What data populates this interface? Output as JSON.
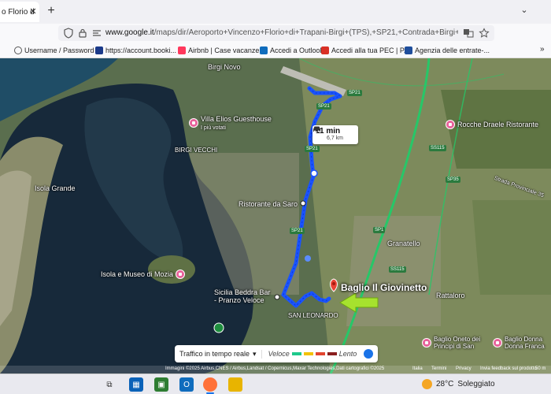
{
  "browser": {
    "tab_title": "o Florio d",
    "tab_close": "✕",
    "new_tab": "+",
    "tab_menu": "⌄",
    "url_host": "www.google.it",
    "url_path": "/maps/dir/Aeroporto+Vincenzo+Florio+di+Trapani-Birgi+(TPS),+SP21,+Contrada+Birgi+Nivaloro,",
    "bookmarks": [
      {
        "label": "Username / Password ...",
        "icon": "globe-icon",
        "color": "#555555"
      },
      {
        "label": "https://account.booki...",
        "icon": "booking-icon",
        "color": "#1b3a8a"
      },
      {
        "label": "Airbnb | Case vacanze,...",
        "icon": "airbnb-icon",
        "color": "#ff385c"
      },
      {
        "label": "Accedi a Outlook",
        "icon": "outlook-icon",
        "color": "#0f6cbd"
      },
      {
        "label": "Accedi alla tua PEC | P...",
        "icon": "pec-icon",
        "color": "#d93025"
      },
      {
        "label": "Agenzia delle entrate-...",
        "icon": "agenzia-icon",
        "color": "#1f4e9c"
      }
    ],
    "bookmarks_more": "»"
  },
  "map": {
    "labels": {
      "birgi_novo": "Birgi Novo",
      "birgi_vecchi": "BIRGI VECCHI",
      "isola_grande": "Isola Grande",
      "granatello": "Granatello",
      "rattaloro": "Rattaloro",
      "san_leonardo": "SAN LEONARDO",
      "strada": "Strada Provinciale 35"
    },
    "places": {
      "villa_elios": "Villa Elios Guesthouse",
      "villa_elios_sub": "I più votati",
      "rocche": "Rocche Draele Ristorante",
      "saro": "Ristorante da Saro",
      "mozia": "Isola e Museo di Mozia",
      "sicilia_line1": "Sicilia Beddra Bar",
      "sicilia_line2": "- Pranzo Veloce",
      "baglio_oneto_1": "Baglio Oneto dei",
      "baglio_oneto_2": "Principi di San",
      "donna_1": "Baglio Donna",
      "donna_2": "Donna Franca"
    },
    "roads": {
      "sp21_a": "SP21",
      "sp21_b": "SP21",
      "sp21_c": "SP21",
      "sp21_d": "SP21",
      "ss115_a": "SS115",
      "ss115_b": "SS115",
      "sp35": "SP35",
      "sp1": "SP1"
    },
    "route": {
      "time": "11 min",
      "distance": "6,7 km",
      "color": "#1a53ff"
    },
    "destination": "Baglio Il Giovinetto",
    "arrow_color": "#a6e22e",
    "traffic": {
      "button": "Traffico in tempo reale",
      "fast": "Veloce",
      "slow": "Lento",
      "colors": [
        "#1ec98c",
        "#f2c200",
        "#e2452f",
        "#8b1f1f"
      ]
    },
    "attribution": "Immagini ©2025 Airbus,CNES / Airbus,Landsat / Copernicus,Maxar Technologies,Dati cartografici ©2025",
    "footer_links": [
      "Italia",
      "Termini",
      "Privacy",
      "Invia feedback sul prodotto",
      "50 m"
    ]
  },
  "taskbar": {
    "temperature": "28°C",
    "weather": "Soleggiato"
  }
}
